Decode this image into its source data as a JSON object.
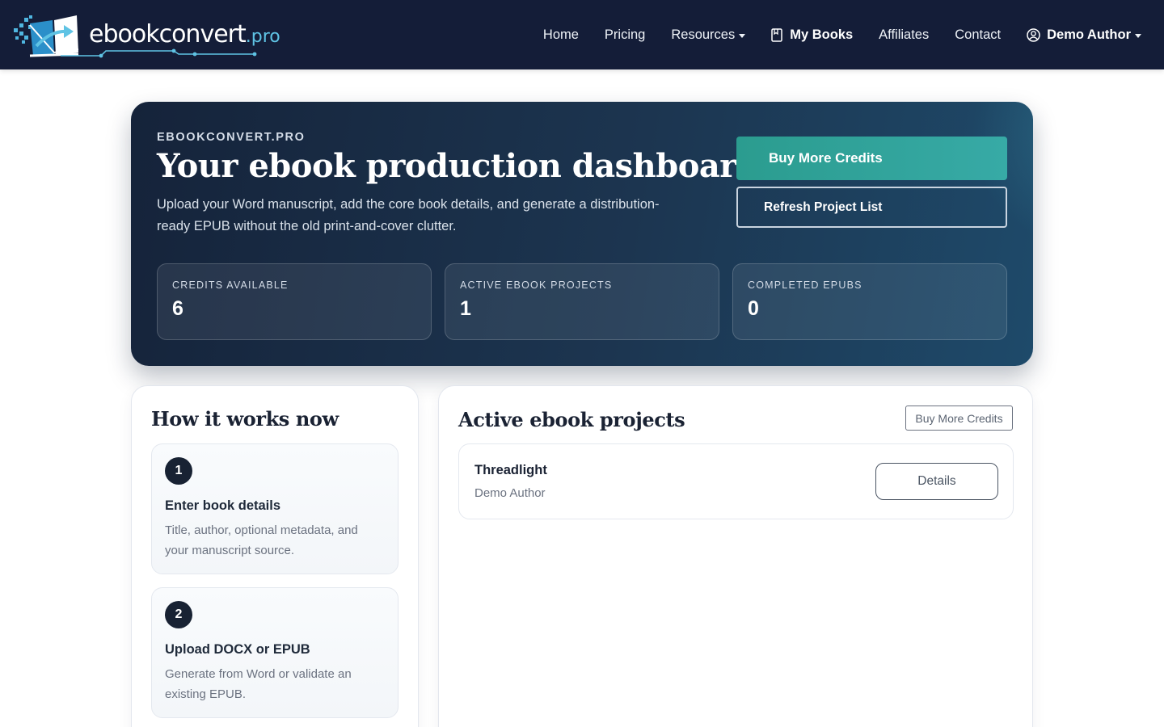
{
  "brand": {
    "name": "ebookconvert",
    "suffix": ".pro"
  },
  "nav": {
    "home": "Home",
    "pricing": "Pricing",
    "resources": "Resources",
    "my_books": "My Books",
    "affiliates": "Affiliates",
    "contact": "Contact",
    "user": "Demo Author"
  },
  "hero": {
    "eyebrow": "EBOOKCONVERT.PRO",
    "title": "Your ebook production dashboard",
    "description": "Upload your Word manuscript, add the core book details, and generate a distribution-ready EPUB without the old print-and-cover clutter.",
    "buy_credits": "Buy More Credits",
    "refresh": "Refresh Project List"
  },
  "stats": [
    {
      "label": "CREDITS AVAILABLE",
      "value": "6"
    },
    {
      "label": "ACTIVE EBOOK PROJECTS",
      "value": "1"
    },
    {
      "label": "COMPLETED EPUBS",
      "value": "0"
    }
  ],
  "how_it_works": {
    "title": "How it works now",
    "steps": [
      {
        "number": "1",
        "title": "Enter book details",
        "description": "Title, author, optional metadata, and your manuscript source."
      },
      {
        "number": "2",
        "title": "Upload DOCX or EPUB",
        "description": "Generate from Word or validate an existing EPUB."
      }
    ]
  },
  "projects": {
    "title": "Active ebook projects",
    "buy_credits": "Buy More Credits",
    "items": [
      {
        "title": "Threadlight",
        "author": "Demo Author",
        "action": "Details"
      }
    ]
  },
  "colors": {
    "navbar": "#141d38",
    "accent": "#2b9c8f",
    "hero_dark": "#15233a",
    "logo_accent": "#5fc3e4"
  },
  "icons": {
    "logo": "open-book-arrow-icon",
    "my_books": "book-icon",
    "user": "user-circle-icon",
    "dropdown": "caret-down-icon"
  }
}
